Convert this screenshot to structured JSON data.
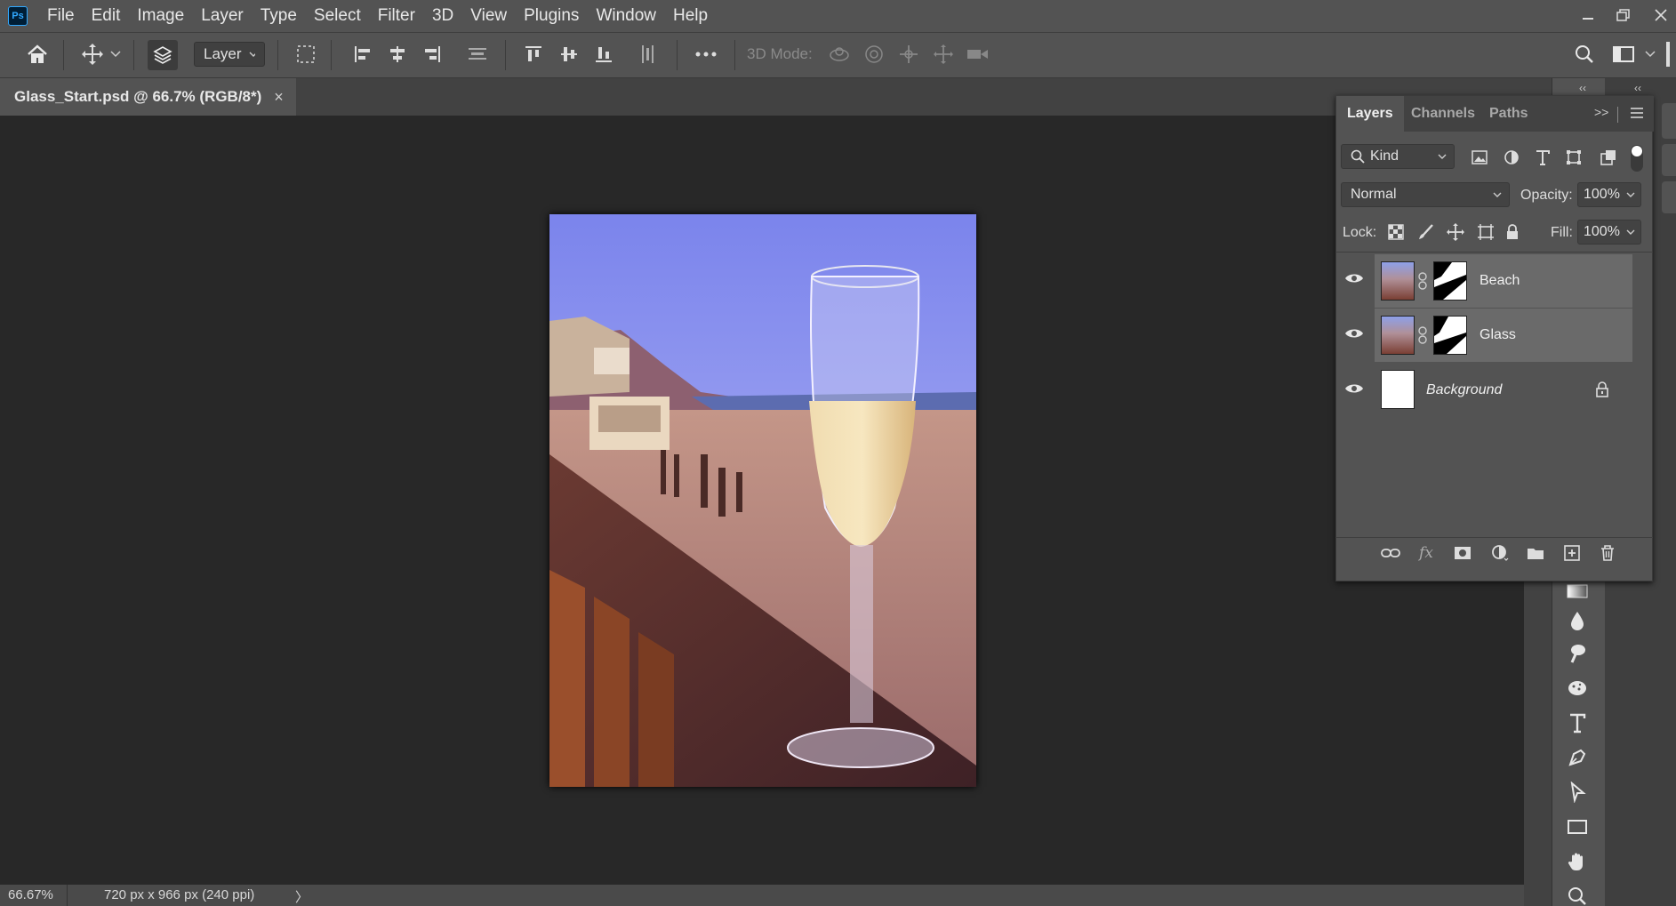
{
  "app": {
    "logo": "Ps",
    "menu": [
      "File",
      "Edit",
      "Image",
      "Layer",
      "Type",
      "Select",
      "Filter",
      "3D",
      "View",
      "Plugins",
      "Window",
      "Help"
    ]
  },
  "options_bar": {
    "layer_select": "Layer",
    "three_d_mode": "3D Mode:"
  },
  "document": {
    "tab_title": "Glass_Start.psd @ 66.7% (RGB/8*)",
    "close_glyph": "×"
  },
  "status": {
    "zoom": "66.67%",
    "doc_info": "720 px x 966 px (240 ppi)",
    "arrow": "〉"
  },
  "layers_panel": {
    "tabs": [
      "Layers",
      "Channels",
      "Paths"
    ],
    "filter_kind": "Kind",
    "blend_mode": "Normal",
    "opacity_label": "Opacity:",
    "opacity_value": "100%",
    "lock_label": "Lock:",
    "fill_label": "Fill:",
    "fill_value": "100%",
    "layers": [
      {
        "name": "Beach",
        "visible": true,
        "has_mask": true,
        "selected": true
      },
      {
        "name": "Glass",
        "visible": true,
        "has_mask": true,
        "selected": true
      },
      {
        "name": "Background",
        "visible": true,
        "has_mask": false,
        "locked": true,
        "selected": false
      }
    ],
    "bottom_icons": [
      "link-icon",
      "fx-icon",
      "mask-icon",
      "adjustment-icon",
      "folder-icon",
      "new-layer-icon",
      "trash-icon"
    ],
    "fx_glyph": "fx"
  },
  "colors": {
    "ui_bg": "#535353",
    "canvas_bg": "#282828",
    "accent": "#31a8ff"
  }
}
